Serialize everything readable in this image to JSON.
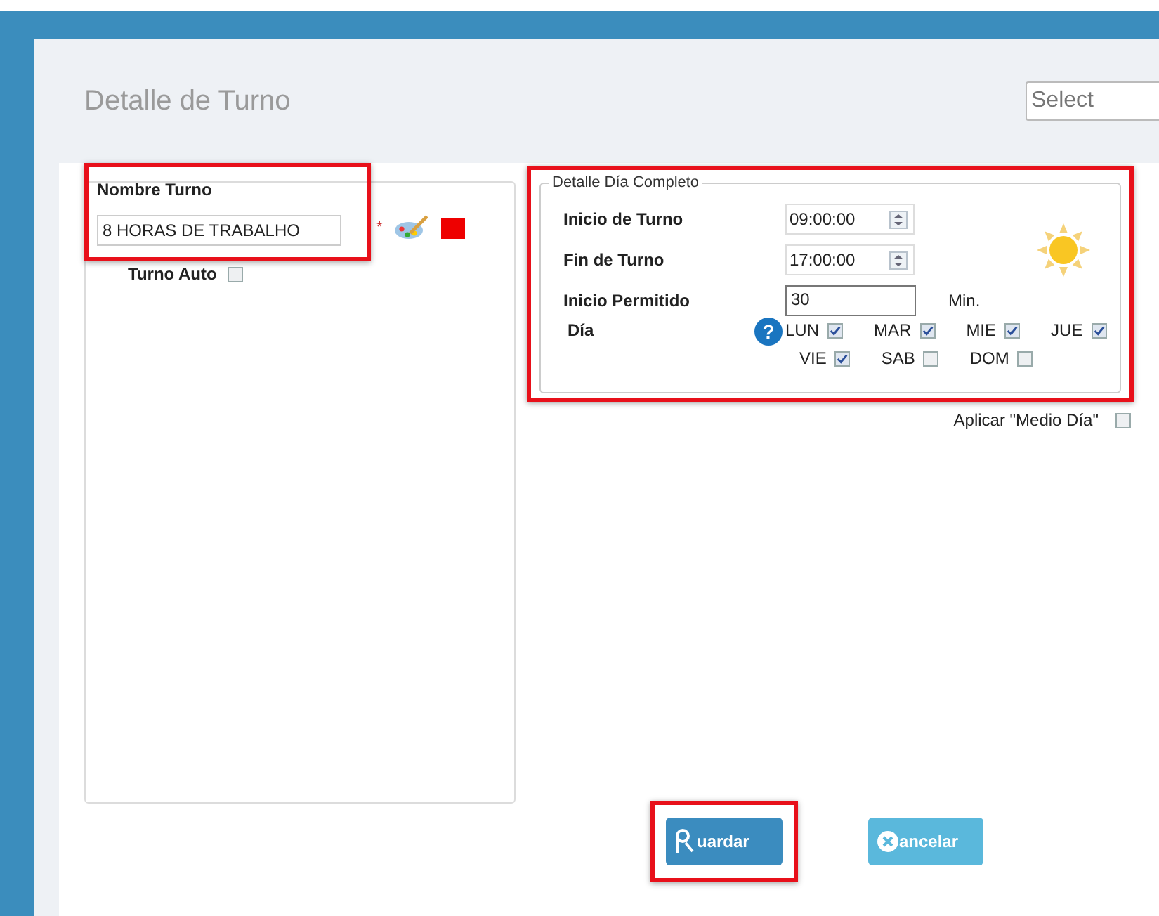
{
  "title": "Detalle de Turno",
  "select": {
    "placeholder": "Select"
  },
  "shift_name": {
    "label": "Nombre Turno",
    "value": "8 HORAS DE TRABALHO",
    "required_mark": "*",
    "color": "#ee0000",
    "highlighted": true
  },
  "auto_shift": {
    "label": "Turno Auto",
    "checked": false
  },
  "full_day": {
    "title": "Detalle Día Completo",
    "highlighted": true,
    "start": {
      "label": "Inicio de Turno",
      "value": "09:00:00"
    },
    "end": {
      "label": "Fin de Turno",
      "value": "17:00:00"
    },
    "allowed": {
      "label": "Inicio Permitido",
      "value": "30",
      "unit": "Min."
    },
    "days_label": "Día",
    "help": "?",
    "days": [
      {
        "label": "LUN",
        "checked": true
      },
      {
        "label": "MAR",
        "checked": true
      },
      {
        "label": "MIE",
        "checked": true
      },
      {
        "label": "JUE",
        "checked": true
      },
      {
        "label": "VIE",
        "checked": true
      },
      {
        "label": "SAB",
        "checked": false
      },
      {
        "label": "DOM",
        "checked": false
      }
    ]
  },
  "half_day": {
    "label": "Aplicar \"Medio Día\"",
    "checked": false
  },
  "buttons": [
    {
      "kind": "save",
      "label": "uardar",
      "highlighted": true
    },
    {
      "kind": "cancel",
      "label": "ancelar",
      "highlighted": false
    }
  ]
}
